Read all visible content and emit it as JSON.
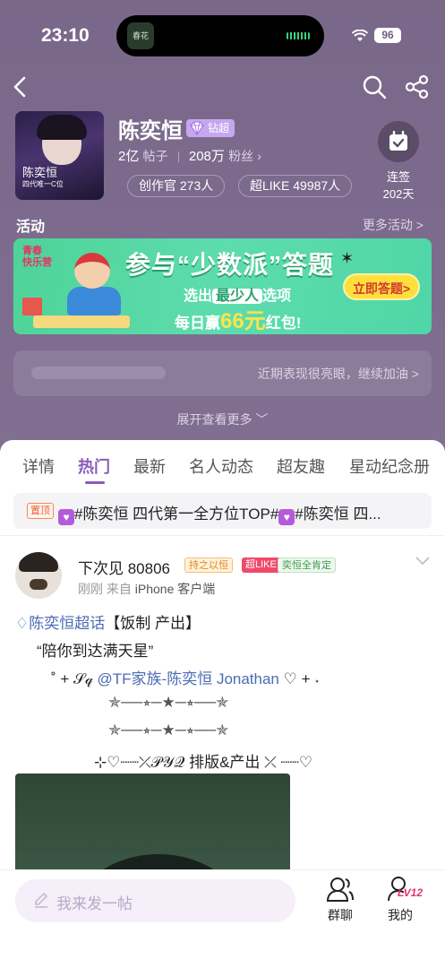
{
  "status_bar": {
    "time": "23:10",
    "battery": "96",
    "island_thumb": "春花"
  },
  "header": {
    "title": "陈奕恒",
    "level_badge": "钻超",
    "posts_count": "2亿",
    "posts_label": "帖子",
    "fans_count": "208万",
    "fans_label": "粉丝",
    "creators_pill": "创作官 273人",
    "superlike_pill": "超LIKE 49987人",
    "checkin_label": "连签",
    "checkin_days": "202天",
    "cover_text_1": "陈奕恒",
    "cover_text_2": "四代唯一C位"
  },
  "activity": {
    "title": "活动",
    "more": "更多活动 >",
    "banner": {
      "logo_line1": "青春",
      "logo_line2": "快乐营",
      "headline": "参与“少数派”答题",
      "sub1_pre": "选出",
      "sub1_hl": "最少人",
      "sub1_post": "选项",
      "sub2_pre": "每日赢",
      "sub2_amount": "66元",
      "sub2_post": "红包!",
      "button": "立即答题>"
    }
  },
  "notice": {
    "text": "近期表现很亮眼，继续加油 >"
  },
  "expand": {
    "label": "展开查看更多 ﹀"
  },
  "tabs": [
    {
      "label": "详情"
    },
    {
      "label": "热门"
    },
    {
      "label": "最新"
    },
    {
      "label": "名人动态"
    },
    {
      "label": "超友趣"
    },
    {
      "label": "星动纪念册"
    }
  ],
  "pinned": {
    "tag": "置顶",
    "text": "#陈奕恒 四代第一全方位TOP#",
    "text2": "#陈奕恒 四..."
  },
  "post": {
    "username": "下次见 80806",
    "badge_1": "持之以恒",
    "badge_2": "超LIKE",
    "badge_3": "奕恒全肯定",
    "time": "刚刚",
    "from_label": "来自",
    "source": "iPhone 客户端",
    "line1_link": "陈奕恒超话",
    "line1_text": "【饭制 产出】",
    "line2": "“陪你到达满天星”",
    "line3_pre": "˚ + 𝒮𝓆 ",
    "line3_link": "@TF家族-陈奕恒 Jonathan",
    "line3_post": " ♡ + ˖",
    "line4": "✯──⭒─★─⭒──✯",
    "line5": "✯──⭒─★─⭒──✯",
    "line6": "⊹♡┈┈⤫𝒫𝒴𝒬 排版&产出 ⤫ ┈┈♡"
  },
  "bottom": {
    "compose_placeholder": "我来发一帖",
    "group_chat": "群聊",
    "mine": "我的",
    "level": "LV12"
  }
}
